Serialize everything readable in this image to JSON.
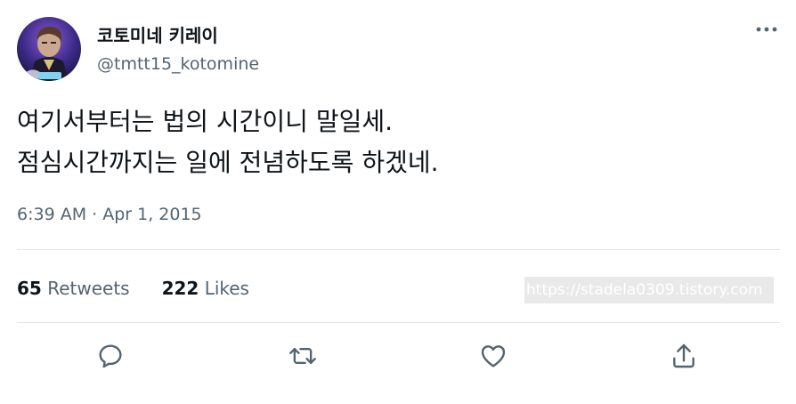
{
  "author": {
    "display_name": "코토미네 키레이",
    "handle": "@tmtt15_kotomine",
    "avatar_icon": "character-avatar-icon"
  },
  "tweet": {
    "line1": "여기서부터는 법의 시간이니 말일세.",
    "line2": "점심시간까지는 일에 전념하도록 하겠네.",
    "timestamp": "6:39 AM · Apr 1, 2015"
  },
  "stats": {
    "retweets_count": "65",
    "retweets_label": "Retweets",
    "likes_count": "222",
    "likes_label": "Likes"
  },
  "watermark": "https://stadela0309.tistory.com",
  "actions": {
    "reply_icon": "reply-icon",
    "retweet_icon": "retweet-icon",
    "like_icon": "heart-icon",
    "share_icon": "share-icon",
    "more_icon": "more-icon"
  },
  "colors": {
    "primary_text": "#0f1419",
    "secondary_text": "#536471",
    "divider": "#e3e6e8"
  }
}
